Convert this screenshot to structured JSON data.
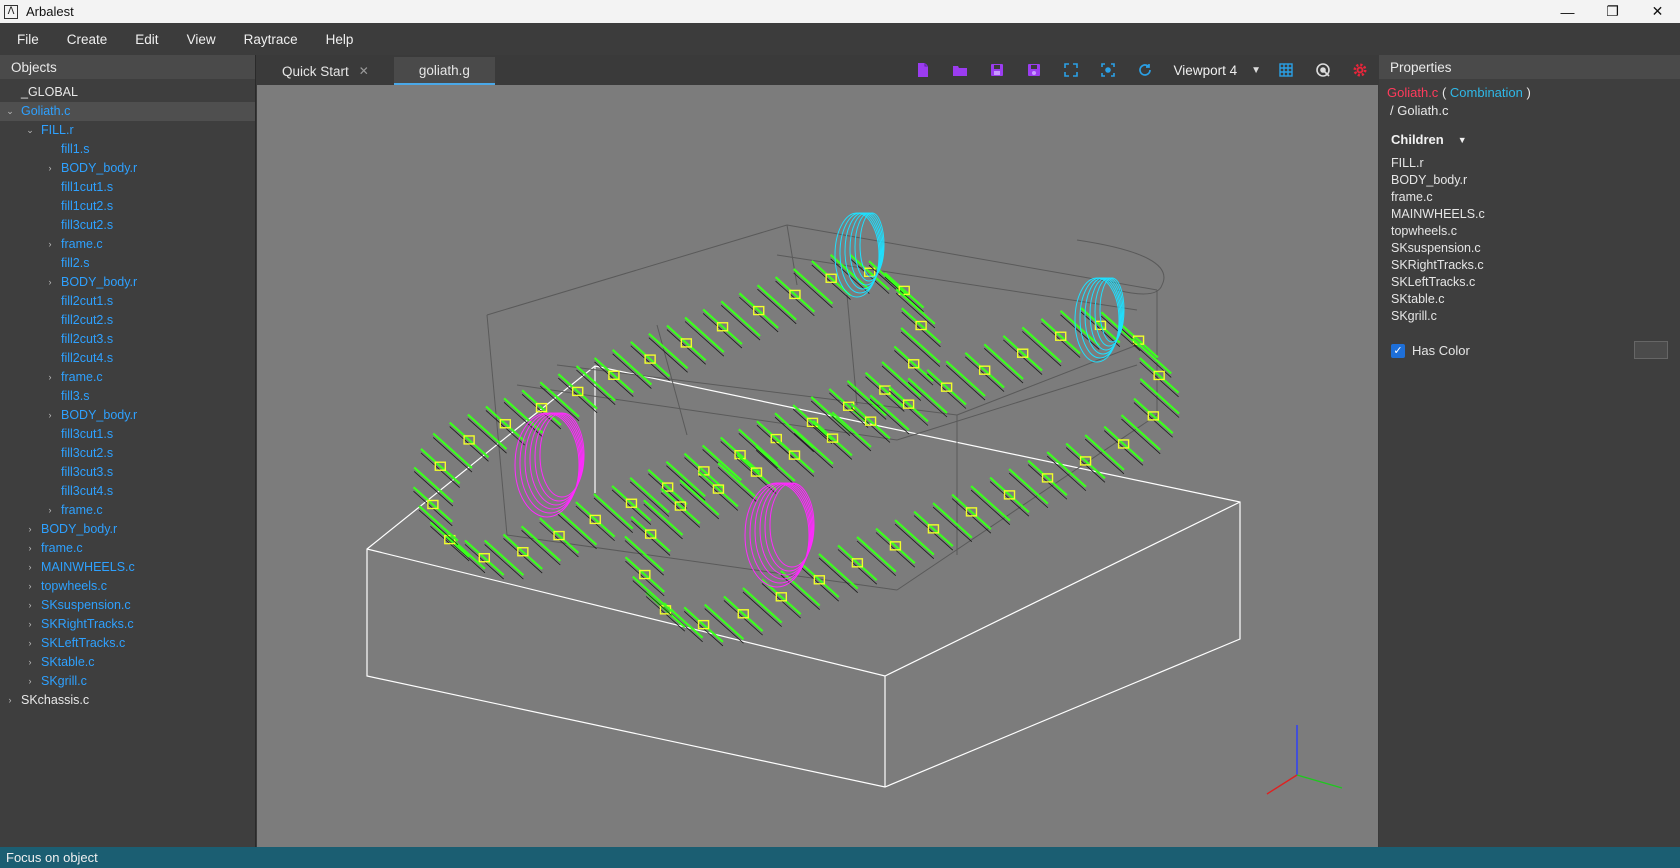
{
  "window": {
    "title": "Arbalest",
    "app_icon": "ᐱ",
    "minimize": "—",
    "maximize": "❐",
    "close": "✕"
  },
  "menu": [
    "File",
    "Create",
    "Edit",
    "View",
    "Raytrace",
    "Help"
  ],
  "objects_panel": {
    "title": "Objects",
    "tree": [
      {
        "label": "_GLOBAL",
        "depth": 0,
        "arrow": "",
        "color": "white"
      },
      {
        "label": "Goliath.c",
        "depth": 0,
        "arrow": "⌄",
        "color": "blue",
        "selected": true
      },
      {
        "label": "FILL.r",
        "depth": 1,
        "arrow": "⌄",
        "color": "blue"
      },
      {
        "label": "fill1.s",
        "depth": 2,
        "arrow": "",
        "color": "blue"
      },
      {
        "label": "BODY_body.r",
        "depth": 2,
        "arrow": "›",
        "color": "blue"
      },
      {
        "label": "fill1cut1.s",
        "depth": 2,
        "arrow": "",
        "color": "blue"
      },
      {
        "label": "fill1cut2.s",
        "depth": 2,
        "arrow": "",
        "color": "blue"
      },
      {
        "label": "fill3cut2.s",
        "depth": 2,
        "arrow": "",
        "color": "blue"
      },
      {
        "label": "frame.c",
        "depth": 2,
        "arrow": "›",
        "color": "blue"
      },
      {
        "label": "fill2.s",
        "depth": 2,
        "arrow": "",
        "color": "blue"
      },
      {
        "label": "BODY_body.r",
        "depth": 2,
        "arrow": "›",
        "color": "blue"
      },
      {
        "label": "fill2cut1.s",
        "depth": 2,
        "arrow": "",
        "color": "blue"
      },
      {
        "label": "fill2cut2.s",
        "depth": 2,
        "arrow": "",
        "color": "blue"
      },
      {
        "label": "fill2cut3.s",
        "depth": 2,
        "arrow": "",
        "color": "blue"
      },
      {
        "label": "fill2cut4.s",
        "depth": 2,
        "arrow": "",
        "color": "blue"
      },
      {
        "label": "frame.c",
        "depth": 2,
        "arrow": "›",
        "color": "blue"
      },
      {
        "label": "fill3.s",
        "depth": 2,
        "arrow": "",
        "color": "blue"
      },
      {
        "label": "BODY_body.r",
        "depth": 2,
        "arrow": "›",
        "color": "blue"
      },
      {
        "label": "fill3cut1.s",
        "depth": 2,
        "arrow": "",
        "color": "blue"
      },
      {
        "label": "fill3cut2.s",
        "depth": 2,
        "arrow": "",
        "color": "blue"
      },
      {
        "label": "fill3cut3.s",
        "depth": 2,
        "arrow": "",
        "color": "blue"
      },
      {
        "label": "fill3cut4.s",
        "depth": 2,
        "arrow": "",
        "color": "blue"
      },
      {
        "label": "frame.c",
        "depth": 2,
        "arrow": "›",
        "color": "blue"
      },
      {
        "label": "BODY_body.r",
        "depth": 1,
        "arrow": "›",
        "color": "blue"
      },
      {
        "label": "frame.c",
        "depth": 1,
        "arrow": "›",
        "color": "blue"
      },
      {
        "label": "MAINWHEELS.c",
        "depth": 1,
        "arrow": "›",
        "color": "blue"
      },
      {
        "label": "topwheels.c",
        "depth": 1,
        "arrow": "›",
        "color": "blue"
      },
      {
        "label": "SKsuspension.c",
        "depth": 1,
        "arrow": "›",
        "color": "blue"
      },
      {
        "label": "SKRightTracks.c",
        "depth": 1,
        "arrow": "›",
        "color": "blue"
      },
      {
        "label": "SKLeftTracks.c",
        "depth": 1,
        "arrow": "›",
        "color": "blue"
      },
      {
        "label": "SKtable.c",
        "depth": 1,
        "arrow": "›",
        "color": "blue"
      },
      {
        "label": "SKgrill.c",
        "depth": 1,
        "arrow": "›",
        "color": "blue"
      },
      {
        "label": "SKchassis.c",
        "depth": 0,
        "arrow": "›",
        "color": "white"
      }
    ]
  },
  "tabs": [
    {
      "label": "Quick Start",
      "closable": true,
      "close_glyph": "✕",
      "active": false
    },
    {
      "label": "goliath.g",
      "closable": false,
      "active": true
    }
  ],
  "toolbar": {
    "icons": [
      {
        "name": "new-file-icon",
        "color": "#9b3cf0"
      },
      {
        "name": "open-folder-icon",
        "color": "#9b3cf0"
      },
      {
        "name": "save-icon",
        "color": "#9b3cf0"
      },
      {
        "name": "save-as-icon",
        "color": "#9b3cf0"
      }
    ],
    "view_icons": [
      {
        "name": "fit-view-icon",
        "color": "#2aa0e6"
      },
      {
        "name": "focus-object-icon",
        "color": "#2aa0e6"
      },
      {
        "name": "reset-view-icon",
        "color": "#2aa0e6"
      }
    ],
    "viewport_label": "Viewport 4",
    "viewport_caret": "▼",
    "layout_icon": "grid-layout-icon",
    "raytrace_icon": "raytrace-icon",
    "settings_icon": "gear-icon",
    "settings_color": "#e8253a"
  },
  "properties": {
    "title": "Properties",
    "object_name": "Goliath.c",
    "object_type": "Combination",
    "object_path": "/ Goliath.c",
    "children_label": "Children",
    "children_toggle": "▼",
    "children": [
      "FILL.r",
      "BODY_body.r",
      "frame.c",
      "MAINWHEELS.c",
      "topwheels.c",
      "SKsuspension.c",
      "SKRightTracks.c",
      "SKLeftTracks.c",
      "SKtable.c",
      "SKgrill.c"
    ],
    "has_color_label": "Has Color",
    "has_color_checked": true,
    "has_color_mark": "✓"
  },
  "status": {
    "text": "Focus on object"
  },
  "colors": {
    "link": "#2ea1ff",
    "object_name": "#ff3b5c",
    "object_type": "#2fb8e8",
    "viewport_bg": "#7c7c7c",
    "status_bg": "#1b5e72",
    "track_green": "#3cff1e",
    "track_yellow": "#f2ff2a",
    "wheel_magenta": "#ff2aff",
    "wheel_cyan": "#1ee0ff"
  }
}
